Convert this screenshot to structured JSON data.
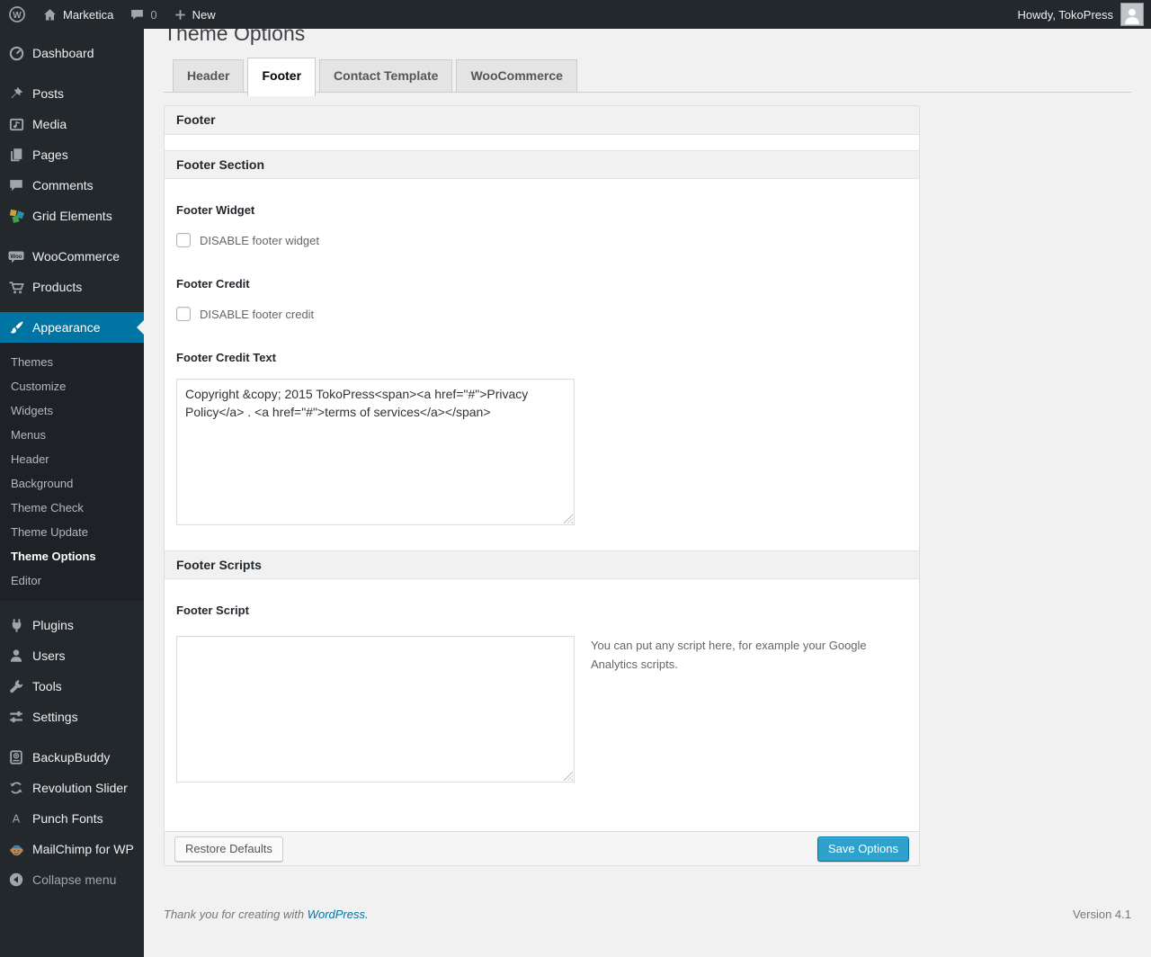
{
  "admin_bar": {
    "site_name": "Marketica",
    "comment_count": "0",
    "new_label": "New",
    "howdy": "Howdy, TokoPress"
  },
  "icons": {
    "wp_logo_letter": "W",
    "woo_badge_text": "Woo",
    "punch_fonts_letter": "A",
    "new_plus": "+"
  },
  "sidebar": {
    "menu": [
      {
        "label": "Dashboard",
        "icon": "dashboard-icon"
      },
      {
        "label": "Posts",
        "icon": "pushpin-icon"
      },
      {
        "label": "Media",
        "icon": "media-icon"
      },
      {
        "label": "Pages",
        "icon": "pages-icon"
      },
      {
        "label": "Comments",
        "icon": "comments-icon"
      },
      {
        "label": "Grid Elements",
        "icon": "grid-elements-icon"
      },
      {
        "label": "WooCommerce",
        "icon": "woocommerce-icon"
      },
      {
        "label": "Products",
        "icon": "cart-icon"
      },
      {
        "label": "Appearance",
        "icon": "paintbrush-icon",
        "active": true
      },
      {
        "label": "Plugins",
        "icon": "plugin-icon"
      },
      {
        "label": "Users",
        "icon": "user-icon"
      },
      {
        "label": "Tools",
        "icon": "wrench-icon"
      },
      {
        "label": "Settings",
        "icon": "sliders-icon"
      },
      {
        "label": "BackupBuddy",
        "icon": "backup-icon"
      },
      {
        "label": "Revolution Slider",
        "icon": "rotate-arrows-icon"
      },
      {
        "label": "Punch Fonts",
        "icon": "letter-a-icon"
      },
      {
        "label": "MailChimp for WP",
        "icon": "monkey-icon"
      },
      {
        "label": "Collapse menu",
        "icon": "collapse-arrow-icon"
      }
    ],
    "appearance_submenu": {
      "items": [
        "Themes",
        "Customize",
        "Widgets",
        "Menus",
        "Header",
        "Background",
        "Theme Check",
        "Theme Update",
        "Theme Options",
        "Editor"
      ],
      "active_item": "Theme Options"
    }
  },
  "page": {
    "title": "Theme Options",
    "tabs": [
      {
        "label": "Header",
        "active": false
      },
      {
        "label": "Footer",
        "active": true
      },
      {
        "label": "Contact Template",
        "active": false
      },
      {
        "label": "WooCommerce",
        "active": false
      }
    ]
  },
  "panel": {
    "title": "Footer",
    "section1_title": "Footer Section",
    "section2_title": "Footer Scripts",
    "footer_widget": {
      "label": "Footer Widget",
      "checkbox_label": "DISABLE footer widget",
      "checked": false
    },
    "footer_credit": {
      "label": "Footer Credit",
      "checkbox_label": "DISABLE footer credit",
      "checked": false
    },
    "footer_credit_text": {
      "label": "Footer Credit Text",
      "value": "Copyright &copy; 2015 TokoPress<span><a href=\"#\">Privacy Policy</a> . <a href=\"#\">terms of services</a></span>"
    },
    "footer_script": {
      "label": "Footer Script",
      "value": "",
      "help": "You can put any script here, for example your Google Analytics scripts."
    },
    "buttons": {
      "restore": "Restore Defaults",
      "save": "Save Options"
    }
  },
  "page_footer": {
    "thanks_text": "Thank you for creating with",
    "wordpress_link": "WordPress.",
    "version": "Version 4.1"
  },
  "colors": {
    "admin_bar_bg": "#23282d",
    "menu_bg": "#23282d",
    "menu_active_bg": "#0074a2",
    "primary_button_bg": "#2ea2cc",
    "primary_button_border": "#0074a2",
    "link": "#0074a2",
    "page_bg": "#f1f1f1"
  }
}
